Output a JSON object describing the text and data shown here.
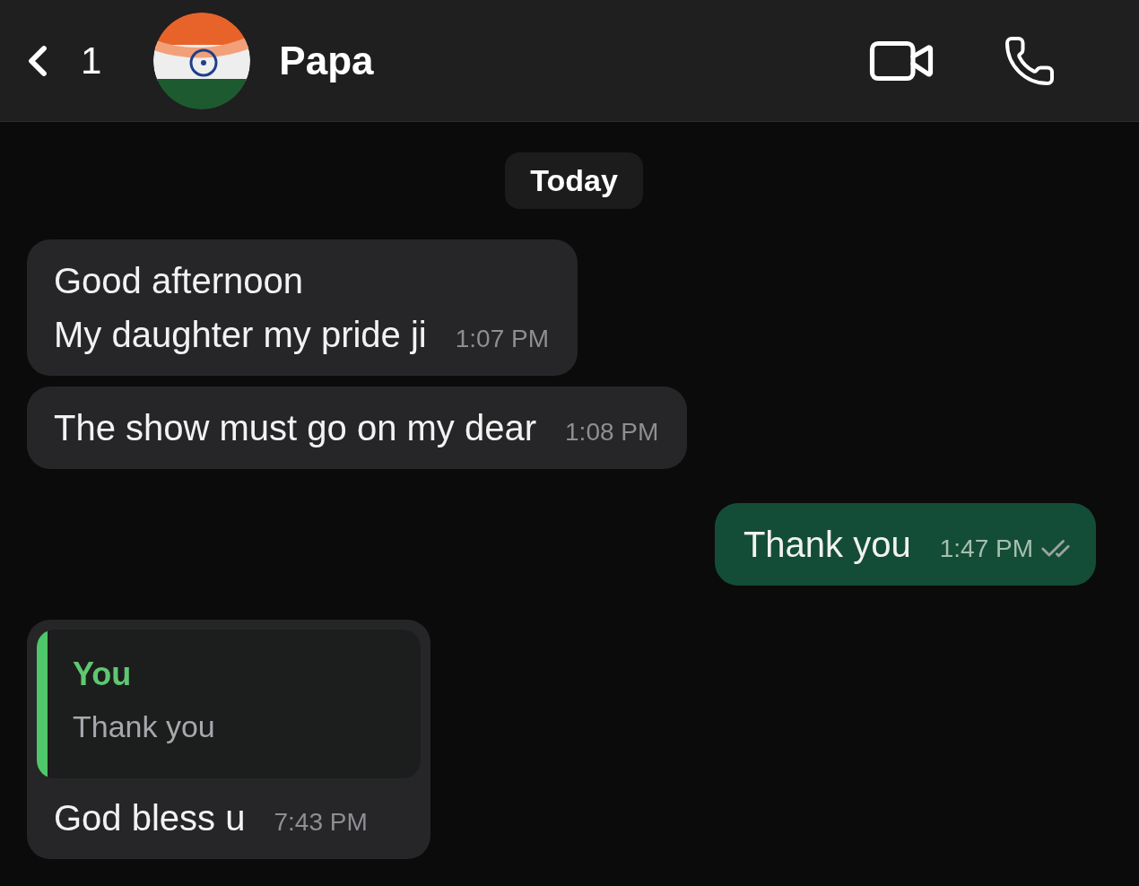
{
  "header": {
    "back_count": "1",
    "contact_name": "Papa"
  },
  "date_chip": "Today",
  "messages": [
    {
      "kind": "incoming",
      "lines": [
        "Good afternoon",
        "My daughter my pride ji"
      ],
      "time": "1:07 PM"
    },
    {
      "kind": "incoming",
      "lines": [
        "The show must go on my dear"
      ],
      "time": "1:08 PM"
    },
    {
      "kind": "outgoing",
      "lines": [
        "Thank you"
      ],
      "time": "1:47 PM",
      "read": false
    },
    {
      "kind": "reply",
      "quote_author": "You",
      "quote_text": "Thank you",
      "lines": [
        "God bless u"
      ],
      "time": "7:43 PM"
    }
  ]
}
